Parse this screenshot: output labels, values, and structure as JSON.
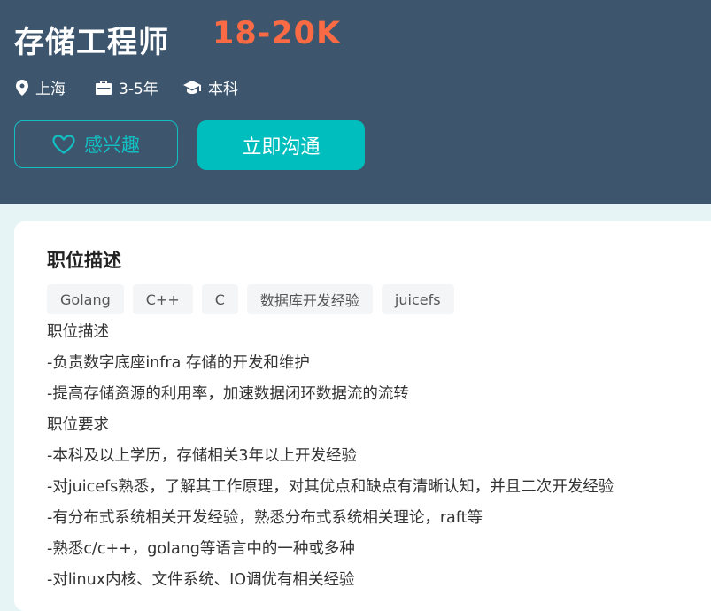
{
  "job": {
    "title": "存储工程师",
    "salary": "18-20K",
    "location": "上海",
    "experience": "3-5年",
    "degree": "本科"
  },
  "actions": {
    "interest_label": "感兴趣",
    "chat_label": "立即沟通"
  },
  "description": {
    "section_title": "职位描述",
    "tags": [
      "Golang",
      "C++",
      "C",
      "数据库开发经验",
      "juicefs"
    ],
    "lines": [
      "职位描述",
      "-负责数字底座infra 存储的开发和维护",
      "-提高存储资源的利用率，加速数据闭环数据流的流转",
      "职位要求",
      "-本科及以上学历，存储相关3年以上开发经验",
      "-对juicefs熟悉，了解其工作原理，对其优点和缺点有清晰认知，并且二次开发经验",
      "-有分布式系统相关开发经验，熟悉分布式系统相关理论，raft等",
      "-熟悉c/c++，golang等语言中的一种或多种",
      "-对linux内核、文件系统、IO调优有相关经验"
    ]
  },
  "colors": {
    "header_bg": "#3d566e",
    "salary": "#fa6a45",
    "accent": "#00bebd",
    "page_bg": "#e6f4f6"
  },
  "icons": [
    "location-icon",
    "briefcase-icon",
    "graduation-cap-icon",
    "heart-icon"
  ]
}
